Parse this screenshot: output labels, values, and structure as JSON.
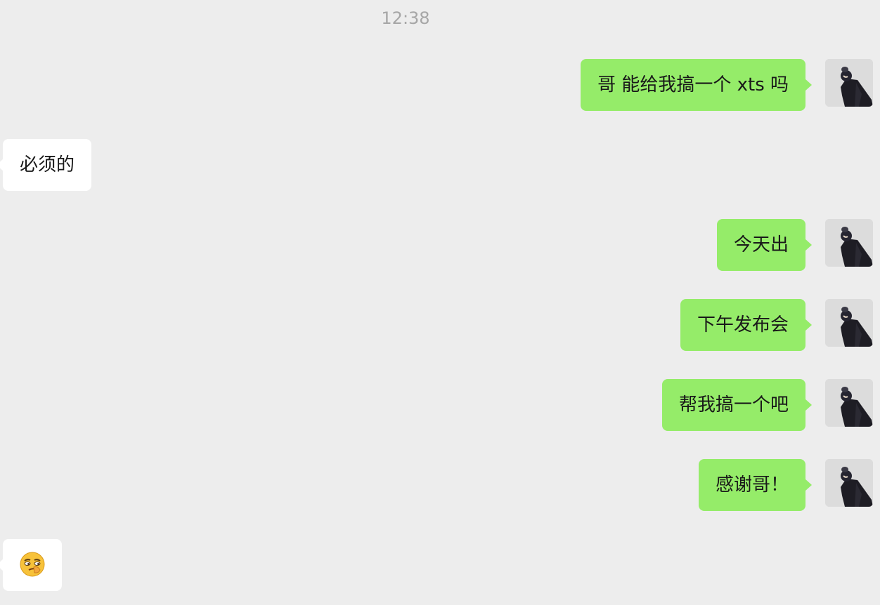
{
  "chat": {
    "timestamp": "12:38",
    "messages": [
      {
        "side": "out",
        "text": "哥 能给我搞一个 xts 吗"
      },
      {
        "side": "in",
        "text": "必须的"
      },
      {
        "side": "out",
        "text": "今天出"
      },
      {
        "side": "out",
        "text": "下午发布会"
      },
      {
        "side": "out",
        "text": "帮我搞一个吧"
      },
      {
        "side": "out",
        "text": "感谢哥！"
      },
      {
        "side": "in",
        "icon": "smirk-emoji-icon"
      }
    ]
  },
  "colors": {
    "background": "#ededed",
    "outgoing_bubble": "#95ec69",
    "incoming_bubble": "#ffffff",
    "timestamp_text": "#a6a6a6"
  }
}
